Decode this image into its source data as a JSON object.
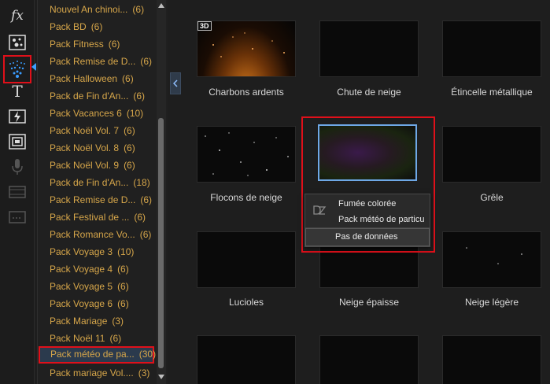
{
  "toolbar": {
    "tools": [
      {
        "name": "fx",
        "label": "fx"
      },
      {
        "name": "effects-grid-icon"
      },
      {
        "name": "particle-icon"
      },
      {
        "name": "title-icon",
        "label": "T"
      },
      {
        "name": "transition-icon"
      },
      {
        "name": "pip-icon"
      },
      {
        "name": "microphone-icon"
      },
      {
        "name": "chapter-icon"
      },
      {
        "name": "subtitle-icon"
      }
    ]
  },
  "categories": [
    {
      "label": "Nouvel An chinoi...",
      "count": "(6)"
    },
    {
      "label": "Pack BD",
      "count": "(6)"
    },
    {
      "label": "Pack Fitness",
      "count": "(6)"
    },
    {
      "label": "Pack Remise de D...",
      "count": "(6)"
    },
    {
      "label": "Pack Halloween",
      "count": "(6)"
    },
    {
      "label": "Pack de Fin d'An...",
      "count": "(6)"
    },
    {
      "label": "Pack Vacances 6",
      "count": "(10)"
    },
    {
      "label": "Pack Noël Vol. 7",
      "count": "(6)"
    },
    {
      "label": "Pack Noël Vol. 8",
      "count": "(6)"
    },
    {
      "label": "Pack Noël Vol. 9",
      "count": "(6)"
    },
    {
      "label": "Pack de Fin d'An...",
      "count": "(18)"
    },
    {
      "label": "Pack Remise de D...",
      "count": "(6)"
    },
    {
      "label": "Pack Festival de ...",
      "count": "(6)"
    },
    {
      "label": "Pack Romance Vo...",
      "count": "(6)"
    },
    {
      "label": "Pack Voyage 3",
      "count": "(10)"
    },
    {
      "label": "Pack Voyage 4",
      "count": "(6)"
    },
    {
      "label": "Pack Voyage 5",
      "count": "(6)"
    },
    {
      "label": "Pack Voyage 6",
      "count": "(6)"
    },
    {
      "label": "Pack Mariage",
      "count": "(3)"
    },
    {
      "label": "Pack Noël 11",
      "count": "(6)"
    },
    {
      "label": "Pack météo de pa...",
      "count": "(30)",
      "selected": true
    },
    {
      "label": "Pack mariage Vol....",
      "count": "(3)"
    }
  ],
  "tiles": [
    {
      "label": "Charbons ardents",
      "badge": "3D"
    },
    {
      "label": "Chute de neige"
    },
    {
      "label": "Étincelle métallique"
    },
    {
      "label": "Flocons de neige"
    },
    {
      "label": "Fumée colorée",
      "selected": true
    },
    {
      "label": "Grêle"
    },
    {
      "label": "Lucioles"
    },
    {
      "label": "Neige épaisse"
    },
    {
      "label": "Neige légère"
    },
    {
      "label": ""
    },
    {
      "label": ""
    },
    {
      "label": ""
    }
  ],
  "context_menu": {
    "item1": "Fumée colorée",
    "item2": "Pack météo de particu",
    "no_data": "Pas de données"
  },
  "colors": {
    "category_text": "#d6a64a",
    "highlight": "#e0101a",
    "selection_border": "#6ea8e6"
  }
}
